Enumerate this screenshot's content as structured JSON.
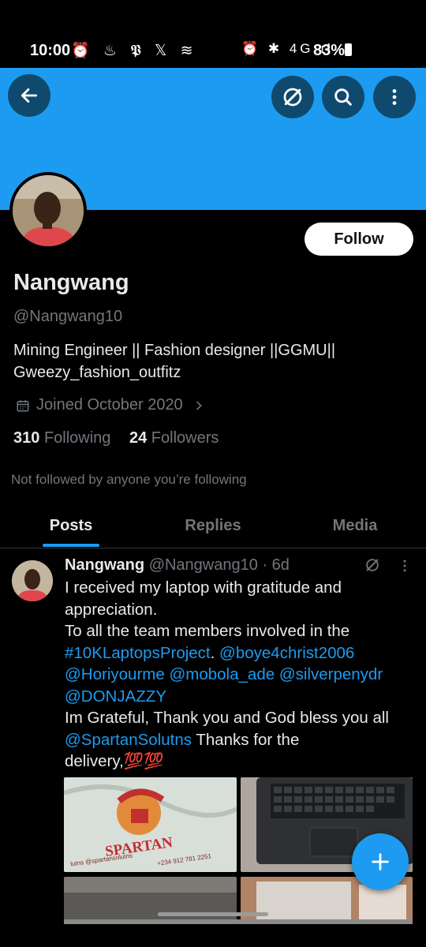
{
  "status_bar": {
    "time": "10:00",
    "left_icons": "⏰ ♨ 𝕻 𝕏 ≋",
    "right_icons": "⏰ ✱ 4G ıl",
    "battery": "83%"
  },
  "header": {
    "back_icon": "arrow-left-icon",
    "grok_icon": "grok-slash-icon",
    "search_icon": "search-icon",
    "more_icon": "more-vertical-icon"
  },
  "profile": {
    "follow_label": "Follow",
    "display_name": "Nangwang",
    "handle": "@Nangwang10",
    "bio_line1": "Mining Engineer || Fashion designer ||GGMU||",
    "bio_line2": "Gweezy_fashion_outfitz",
    "joined": "Joined October 2020",
    "following_count": "310",
    "following_label": "Following",
    "followers_count": "24",
    "followers_label": "Followers",
    "not_followed": "Not followed by anyone you’re following"
  },
  "tabs": [
    {
      "label": "Posts",
      "active": true
    },
    {
      "label": "Replies",
      "active": false
    },
    {
      "label": "Media",
      "active": false
    }
  ],
  "post": {
    "name": "Nangwang",
    "meta": "@Nangwang10 · 6d",
    "line1": "I received my laptop with gratitude and",
    "line2": "appreciation.",
    "line3": "To all the team members involved in the",
    "hashtag": "#10KLaptopsProject",
    "line4_dot": ". ",
    "mention1": "@boye4christ2006",
    "mention2": "@Horiyourme",
    "mention3": "@mobola_ade",
    "mention4": "@silverpenydr",
    "mention5": "@DONJAZZY",
    "line7": "Im Grateful, Thank you and God bless you all",
    "mention6": "@SpartanSolutns",
    "line8_rest": " Thanks for the",
    "line9": "delivery,💯💯",
    "image1_text": "SPARTAN",
    "image1_small": "lutns @spartansolutns",
    "image1_phone": "+234 912 781 2251"
  },
  "colors": {
    "accent": "#1d9bf0",
    "background": "#000000",
    "text": "#e7e9ea",
    "muted": "#71767b"
  }
}
